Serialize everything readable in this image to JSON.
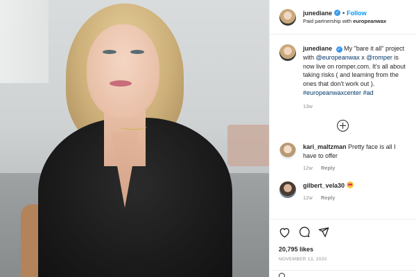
{
  "post": {
    "author": "junediane",
    "follow_label": "Follow",
    "separator": "•",
    "partnership_prefix": "Paid partnership with",
    "partner": "europeanwax"
  },
  "caption": {
    "author": "junediane",
    "text_1": "My \"bare it all\" project with",
    "mention_1": "@europeanwax",
    "text_2": "x",
    "mention_2": "@romper",
    "text_3": "is now live on romper.com. It's all about taking risks ( and learning from the ones that don't work out ).",
    "hashtag_1": "#europeanwaxcenter",
    "hashtag_2": "#ad",
    "time": "13w"
  },
  "comments": [
    {
      "author": "kari_maltzman",
      "text": "Pretty face is all I have to offer",
      "time": "12w",
      "reply_label": "Reply"
    },
    {
      "author": "gilbert_vela30",
      "emoji": "heart-eyes-emoji",
      "time": "12w",
      "reply_label": "Reply"
    }
  ],
  "likes": "20,795 likes",
  "date": "NOVEMBER 13, 2020",
  "icons": [
    "heart-icon",
    "comment-icon",
    "share-icon",
    "add-comments-icon"
  ],
  "colors": {
    "link": "#0095f6",
    "tag": "#00376b",
    "verified": "#3897f0",
    "muted": "#8e8e8e"
  }
}
